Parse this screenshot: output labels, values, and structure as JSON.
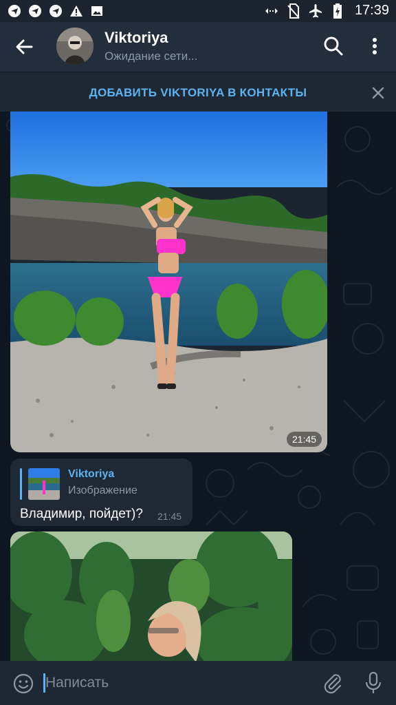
{
  "status_bar": {
    "time": "17:39",
    "icons": [
      "telegram-icon",
      "telegram-icon",
      "telegram-icon",
      "warning-icon",
      "image-icon",
      "data-saver-icon",
      "no-sim-icon",
      "airplane-icon",
      "battery-icon"
    ]
  },
  "header": {
    "title": "Viktoriya",
    "status": "Ожидание сети..."
  },
  "banner": {
    "add_contact": "ДОБАВИТЬ VIKTORIYA В КОНТАКТЫ"
  },
  "messages": {
    "photo1_time": "21:45",
    "reply_name": "Viktoriya",
    "reply_subtitle": "Изображение",
    "text": "Владимир, пойдет)?",
    "text_time": "21:45"
  },
  "composer": {
    "placeholder": "Написать"
  },
  "colors": {
    "accent": "#5db3f2",
    "header_bg": "#232e3c",
    "chat_bg": "#0e1621",
    "bubble_bg": "#1f2936"
  }
}
